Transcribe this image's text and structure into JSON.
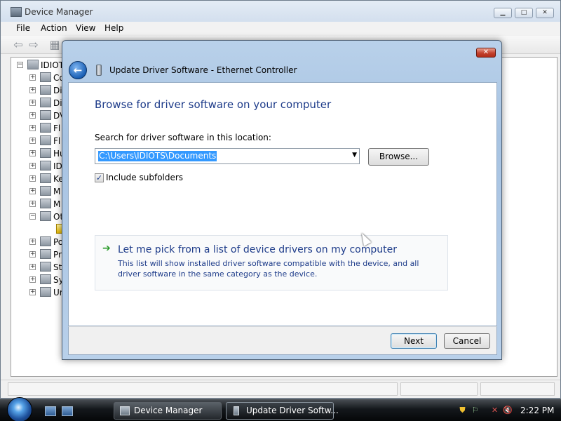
{
  "device_manager": {
    "title": "Device Manager",
    "menu": [
      "File",
      "Action",
      "View",
      "Help"
    ],
    "tree_root": "IDIOT",
    "tree_items": [
      "Co",
      "Di",
      "Di",
      "DV",
      "Fl",
      "Fl",
      "Hu",
      "ID",
      "Ke",
      "M",
      "M",
      "Ot",
      "",
      "Po",
      "Pr",
      "St",
      "Sy",
      "Ur"
    ]
  },
  "dialog": {
    "title": "Update Driver Software - Ethernet Controller",
    "heading": "Browse for driver software on your computer",
    "search_label": "Search for driver software in this location:",
    "path_value": "C:\\Users\\IDIOTS\\Documents",
    "browse_label": "Browse...",
    "include_subfolders_label": "Include subfolders",
    "include_subfolders_checked": true,
    "pick_title": "Let me pick from a list of device drivers on my computer",
    "pick_description": "This list will show installed driver software compatible with the device, and all driver software in the same category as the device.",
    "next_label": "Next",
    "cancel_label": "Cancel"
  },
  "taskbar": {
    "tasks": [
      {
        "label": "Device Manager",
        "active": false
      },
      {
        "label": "Update Driver Softw...",
        "active": true
      }
    ],
    "clock": "2:22 PM"
  },
  "icons": {
    "back": "back-arrow-icon",
    "close": "close-icon",
    "pick_arrow": "green-arrow-icon",
    "start": "windows-start-orb-icon"
  }
}
